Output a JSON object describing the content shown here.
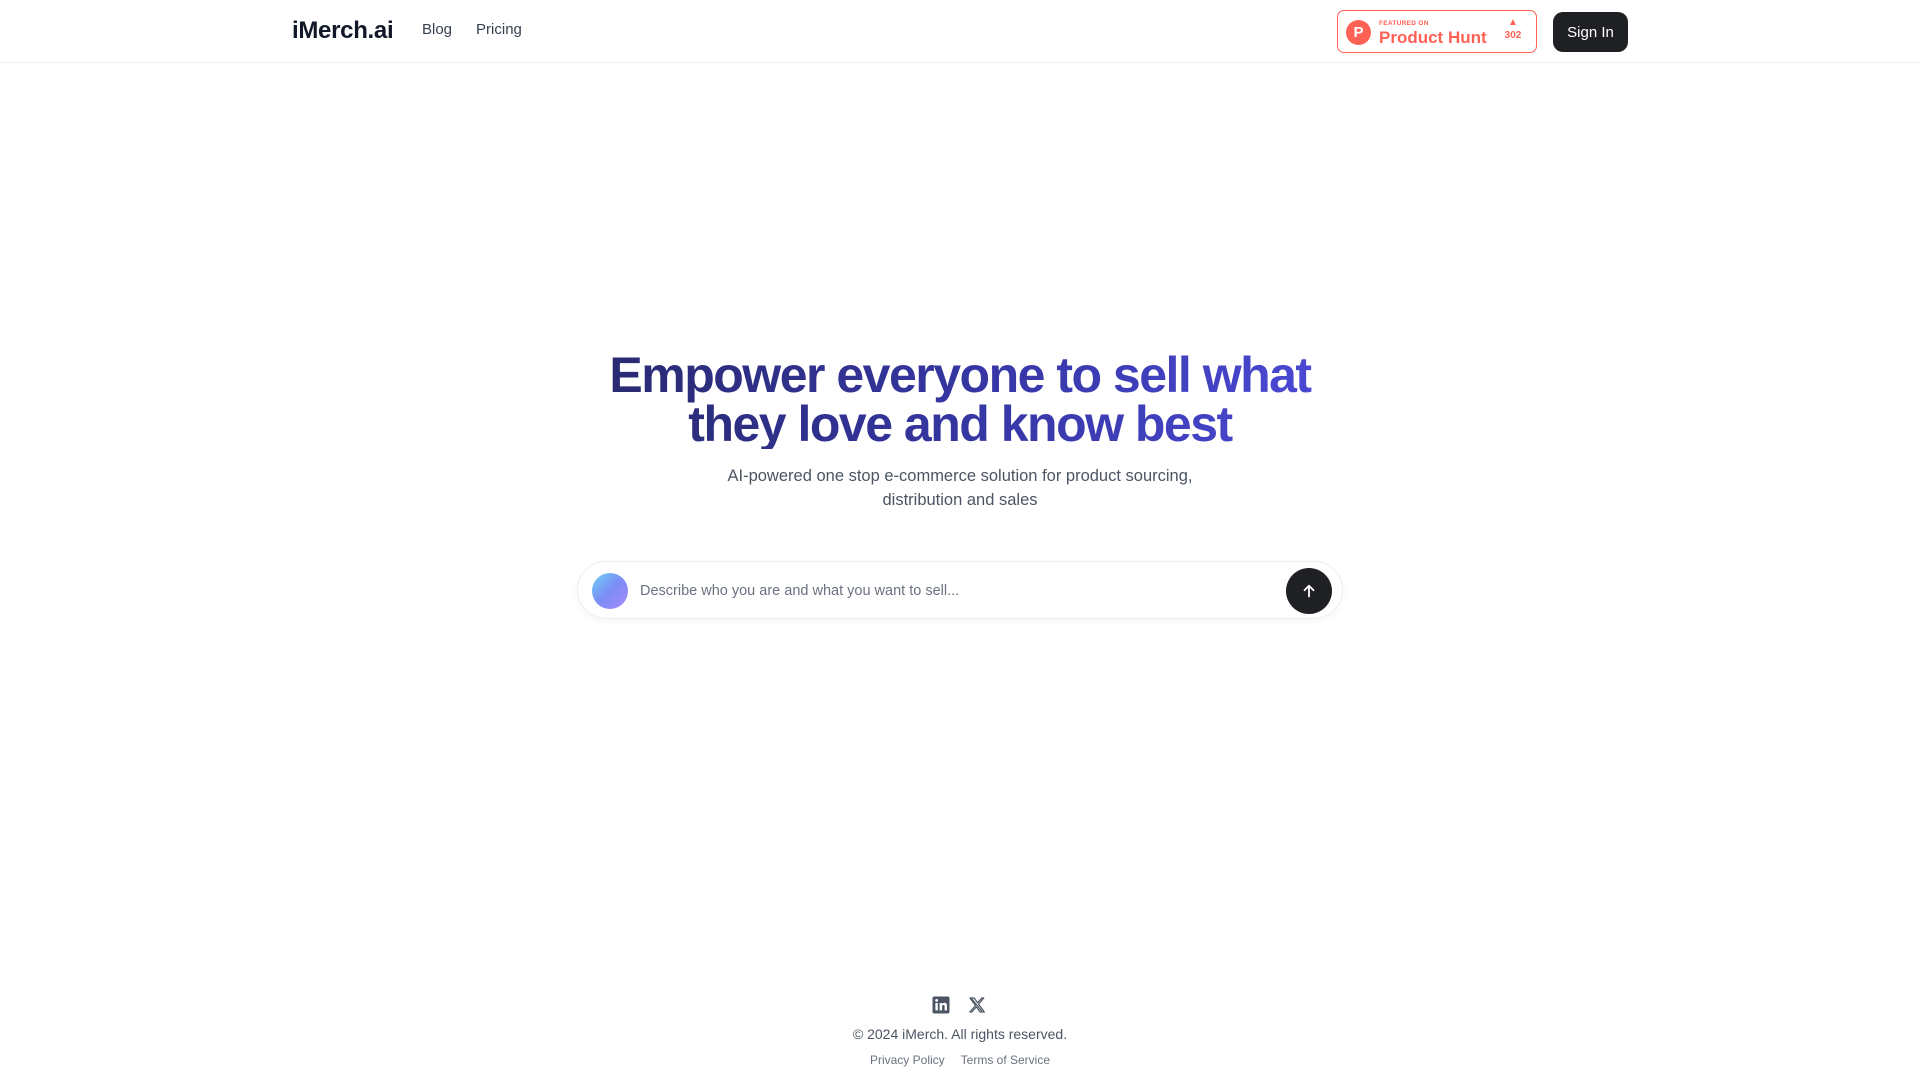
{
  "header": {
    "logo": "iMerch.ai",
    "nav": [
      {
        "label": "Blog"
      },
      {
        "label": "Pricing"
      }
    ],
    "product_hunt": {
      "featured_label": "FEATURED ON",
      "name": "Product Hunt",
      "upvotes": "302",
      "color": "#ff6154"
    },
    "sign_in_label": "Sign In"
  },
  "hero": {
    "title_line1": "Empower everyone to sell what",
    "title_line2": "they love and know best",
    "subtitle_line1": "AI-powered one stop e-commerce solution for product sourcing,",
    "subtitle_line2": "distribution and sales",
    "gradient_colors": [
      "#27296b",
      "#3737a7",
      "#4d4bd9"
    ]
  },
  "prompt": {
    "value": "",
    "placeholder": "Describe who you are and what you want to sell...",
    "send_icon": "arrow-up-icon"
  },
  "footer": {
    "social": [
      {
        "icon": "linkedin-icon"
      },
      {
        "icon": "x-twitter-icon"
      }
    ],
    "copyright": "© 2024 iMerch. All rights reserved.",
    "links": [
      {
        "label": "Privacy Policy"
      },
      {
        "label": "Terms of Service"
      }
    ]
  }
}
